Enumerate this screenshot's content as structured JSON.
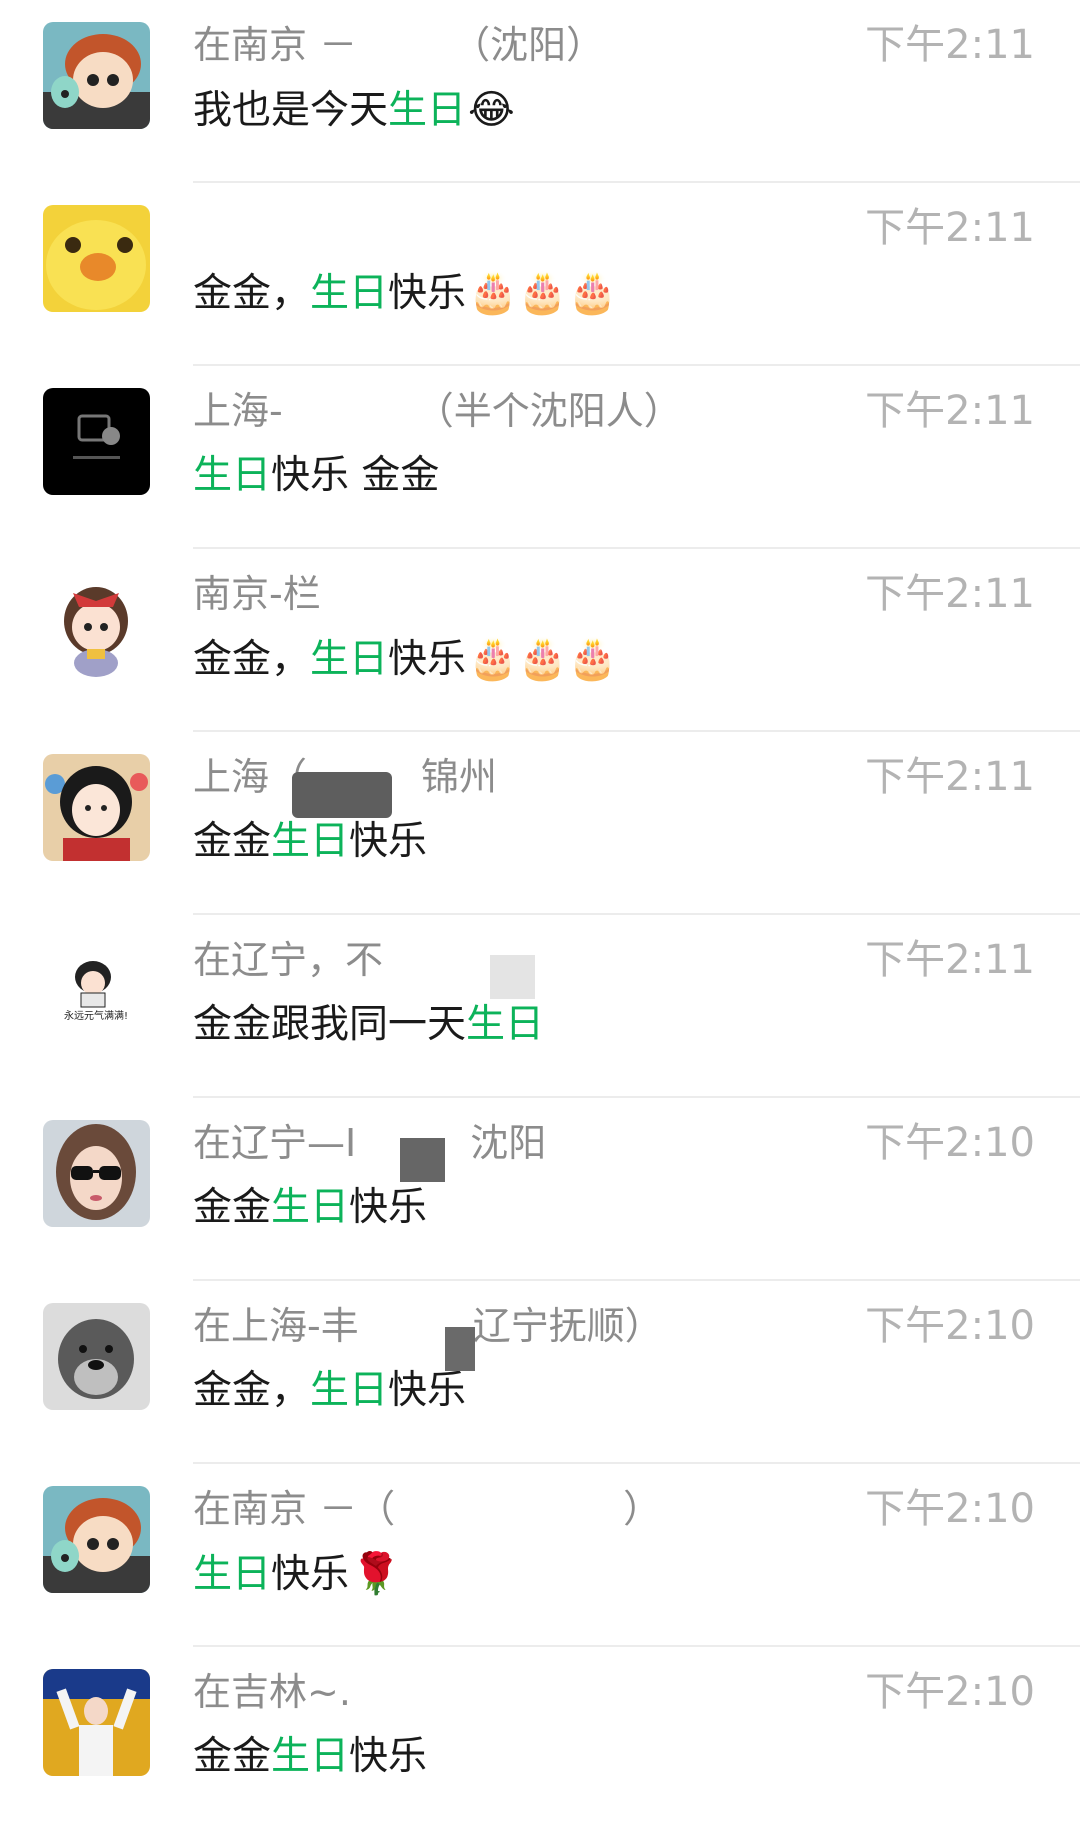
{
  "rows": [
    {
      "avatar": "anime-boy-avatar",
      "name": "在南京 －　　　（沈阳）",
      "time": "下午2:11",
      "message": [
        {
          "text": "我也是今天"
        },
        {
          "text": "生日",
          "highlight": true
        },
        {
          "text": "😂",
          "emoji": true
        }
      ]
    },
    {
      "avatar": "yellow-duck-avatar",
      "name": "",
      "time": "下午2:11",
      "message": [
        {
          "text": "金金，"
        },
        {
          "text": "生日",
          "highlight": true
        },
        {
          "text": "快乐"
        },
        {
          "text": "🎂🎂🎂",
          "emoji": true
        }
      ]
    },
    {
      "avatar": "black-placeholder-avatar",
      "name": "上海-　　　　（半个沈阳人）",
      "time": "下午2:11",
      "message": [
        {
          "text": "生日",
          "highlight": true
        },
        {
          "text": "快乐 金金"
        }
      ]
    },
    {
      "avatar": "cartoon-girl-bow-avatar",
      "name": "南京-栏",
      "time": "下午2:11",
      "message": [
        {
          "text": "金金，"
        },
        {
          "text": "生日",
          "highlight": true
        },
        {
          "text": "快乐"
        },
        {
          "text": "🎂🎂🎂",
          "emoji": true
        }
      ]
    },
    {
      "avatar": "cartoon-girl-dark-hair-avatar",
      "name": "上海（　　　锦州",
      "time": "下午2:11",
      "message": [
        {
          "text": "金金"
        },
        {
          "text": "生日",
          "highlight": true
        },
        {
          "text": "快乐"
        }
      ]
    },
    {
      "avatar": "sketch-girl-sticker-avatar",
      "name": "在辽宁，不",
      "time": "下午2:11",
      "message": [
        {
          "text": "金金跟我同一天"
        },
        {
          "text": "生日",
          "highlight": true
        }
      ]
    },
    {
      "avatar": "sunglasses-woman-avatar",
      "name": "在辽宁—I　　　沈阳",
      "time": "下午2:10",
      "message": [
        {
          "text": "金金"
        },
        {
          "text": "生日",
          "highlight": true
        },
        {
          "text": "快乐"
        }
      ]
    },
    {
      "avatar": "schnauzer-dog-avatar",
      "name": "在上海-丰　　　辽宁抚顺）",
      "time": "下午2:10",
      "message": [
        {
          "text": "金金，"
        },
        {
          "text": "生日",
          "highlight": true
        },
        {
          "text": "快乐"
        }
      ]
    },
    {
      "avatar": "anime-boy-avatar",
      "name": "在南京 －（　　　　　　）",
      "time": "下午2:10",
      "message": [
        {
          "text": "生日",
          "highlight": true
        },
        {
          "text": "快乐"
        },
        {
          "text": "🌹",
          "emoji": true
        }
      ]
    },
    {
      "avatar": "stage-person-avatar",
      "name": "在吉林~.",
      "time": "下午2:10",
      "message": [
        {
          "text": "金金"
        },
        {
          "text": "生日",
          "highlight": true
        },
        {
          "text": "快乐"
        }
      ]
    }
  ],
  "colors": {
    "highlight": "#0cb35a",
    "name": "#8c8c8c",
    "time": "#b3b3b3",
    "message": "#1a1a1a",
    "divider": "#ececec"
  }
}
